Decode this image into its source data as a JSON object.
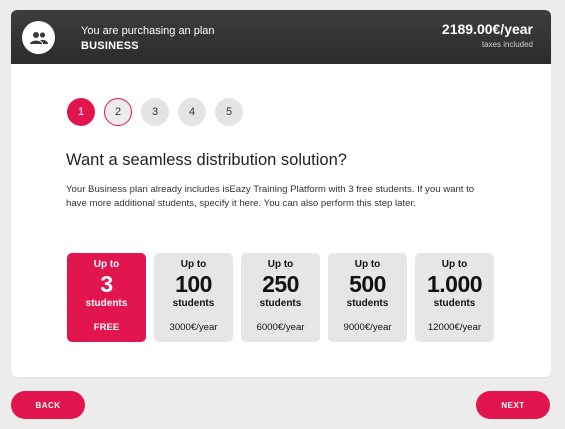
{
  "header": {
    "purchasing_label": "You are purchasing an plan",
    "plan_name": "BUSINESS",
    "price": "2189.00€/year",
    "tax_note": "taxes included",
    "avatar_icon": "users-icon"
  },
  "steps": [
    "1",
    "2",
    "3",
    "4",
    "5"
  ],
  "current_step": 1,
  "main": {
    "question": "Want a seamless distribution solution?",
    "description": "Your Business plan already includes isEazy Training Platform with 3 free students. If you want to have more additional students, specify it here. You can also perform this step later."
  },
  "options": [
    {
      "upto": "Up to",
      "number": "3",
      "students": "students",
      "cost": "FREE",
      "selected": true
    },
    {
      "upto": "Up to",
      "number": "100",
      "students": "students",
      "cost": "3000€/year",
      "selected": false
    },
    {
      "upto": "Up to",
      "number": "250",
      "students": "students",
      "cost": "6000€/year",
      "selected": false
    },
    {
      "upto": "Up to",
      "number": "500",
      "students": "students",
      "cost": "9000€/year",
      "selected": false
    },
    {
      "upto": "Up to",
      "number": "1.000",
      "students": "students",
      "cost": "12000€/year",
      "selected": false
    }
  ],
  "footer": {
    "back_label": "BACK",
    "next_label": "NEXT"
  },
  "colors": {
    "accent": "#e2154f",
    "header_bg": "#333333",
    "page_bg": "#ececec",
    "option_bg": "#e6e6e6"
  }
}
